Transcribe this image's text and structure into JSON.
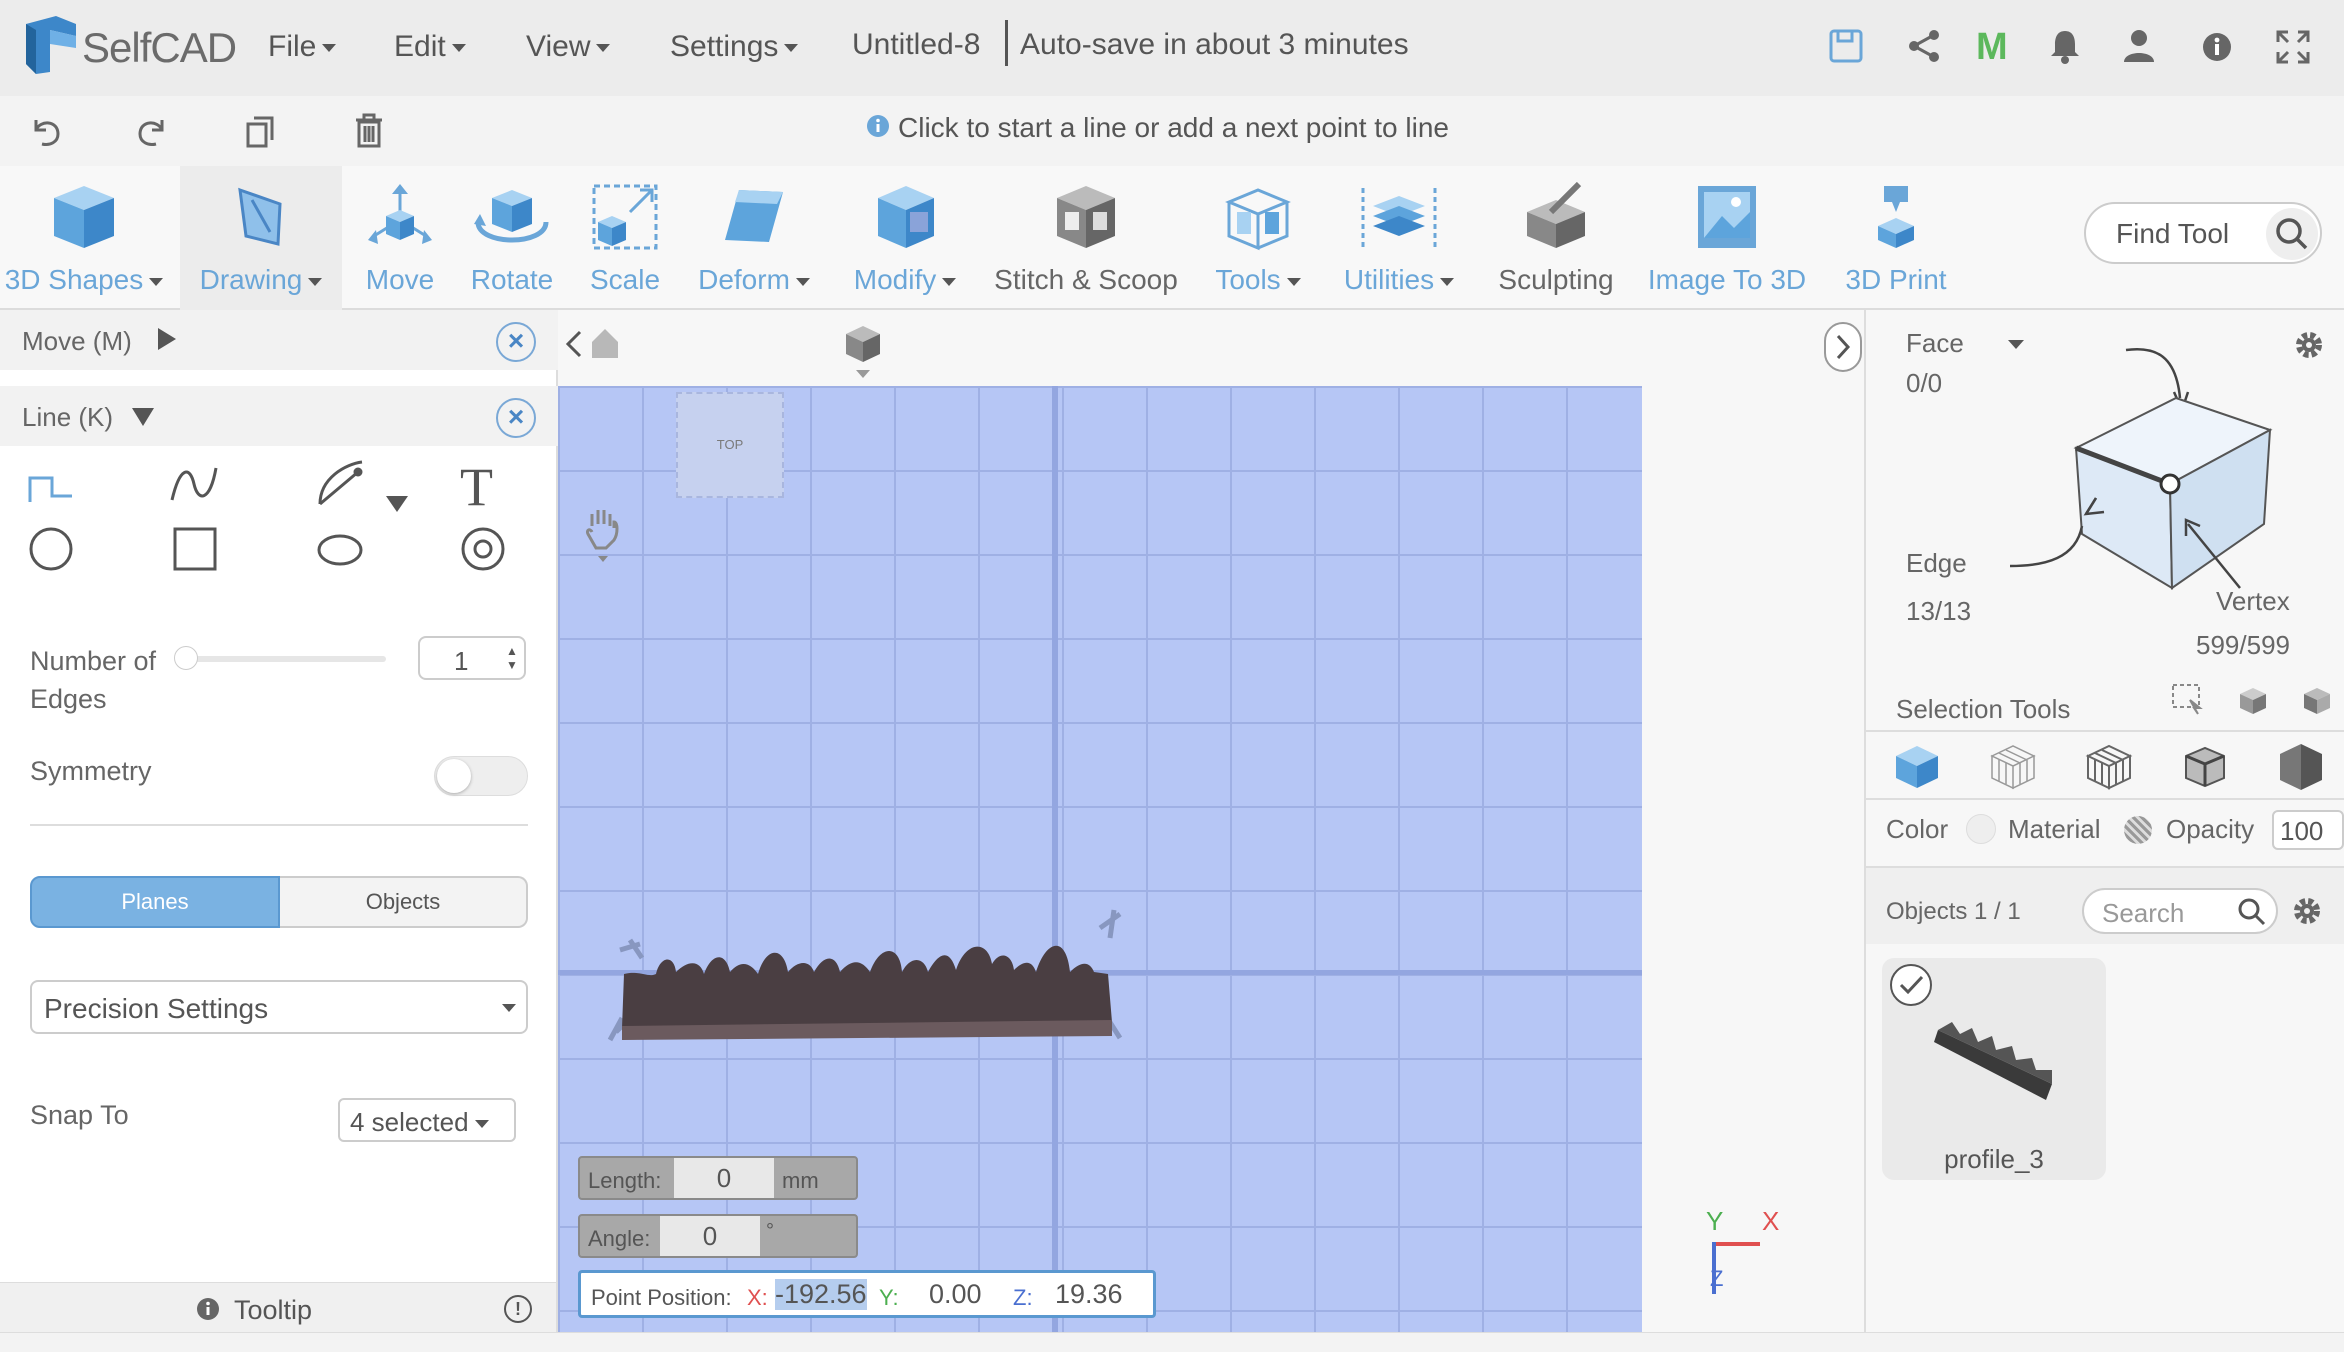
{
  "app": {
    "logo": "SelfCAD",
    "doc_title": "Untitled-8",
    "autosave": "Auto-save in about 3 minutes"
  },
  "menu": [
    {
      "label": "File"
    },
    {
      "label": "Edit"
    },
    {
      "label": "View"
    },
    {
      "label": "Settings"
    }
  ],
  "hint": "Click to start a line or add a next point to line",
  "toolbar": [
    {
      "label": "3D Shapes",
      "dd": true
    },
    {
      "label": "Drawing",
      "dd": true
    },
    {
      "label": "Move"
    },
    {
      "label": "Rotate"
    },
    {
      "label": "Scale"
    },
    {
      "label": "Deform",
      "dd": true
    },
    {
      "label": "Modify",
      "dd": true
    },
    {
      "label": "Stitch & Scoop"
    },
    {
      "label": "Tools",
      "dd": true
    },
    {
      "label": "Utilities",
      "dd": true
    },
    {
      "label": "Sculpting"
    },
    {
      "label": "Image To 3D"
    },
    {
      "label": "3D Print"
    }
  ],
  "find_tool": "Find Tool",
  "left": {
    "move_panel": "Move (M)",
    "line_panel": "Line (K)",
    "edges_label": "Number of Edges",
    "edges_value": "1",
    "symmetry_label": "Symmetry",
    "planes": "Planes",
    "objects": "Objects",
    "precision": "Precision Settings",
    "snap_label": "Snap To",
    "snap_value": "4 selected",
    "tooltip": "Tooltip"
  },
  "viewport": {
    "top_label": "TOP",
    "length_label": "Length:",
    "length_value": "0",
    "length_unit": "mm",
    "angle_label": "Angle:",
    "angle_value": "0",
    "angle_unit": "°",
    "pp_label": "Point Position:",
    "x_label": "X:",
    "x_value": "-192.56",
    "y_label": "Y:",
    "y_value": "0.00",
    "z_label": "Z:",
    "z_value": "19.36",
    "axis_y": "Y",
    "axis_x": "X",
    "axis_z": "Z"
  },
  "right": {
    "face_label": "Face",
    "face_count": "0/0",
    "edge_label": "Edge",
    "edge_count": "13/13",
    "vertex_label": "Vertex",
    "vertex_count": "599/599",
    "selection_tools": "Selection Tools",
    "color_label": "Color",
    "material_label": "Material",
    "opacity_label": "Opacity",
    "opacity_value": "100",
    "objects_label": "Objects 1 / 1",
    "search_placeholder": "Search",
    "object_name": "profile_3"
  },
  "colors": {
    "accent": "#6aa6d8",
    "grid": "#b6c6f5",
    "x_axis": "#e05050",
    "y_axis": "#4caf50",
    "z_axis": "#4a6fd0"
  }
}
